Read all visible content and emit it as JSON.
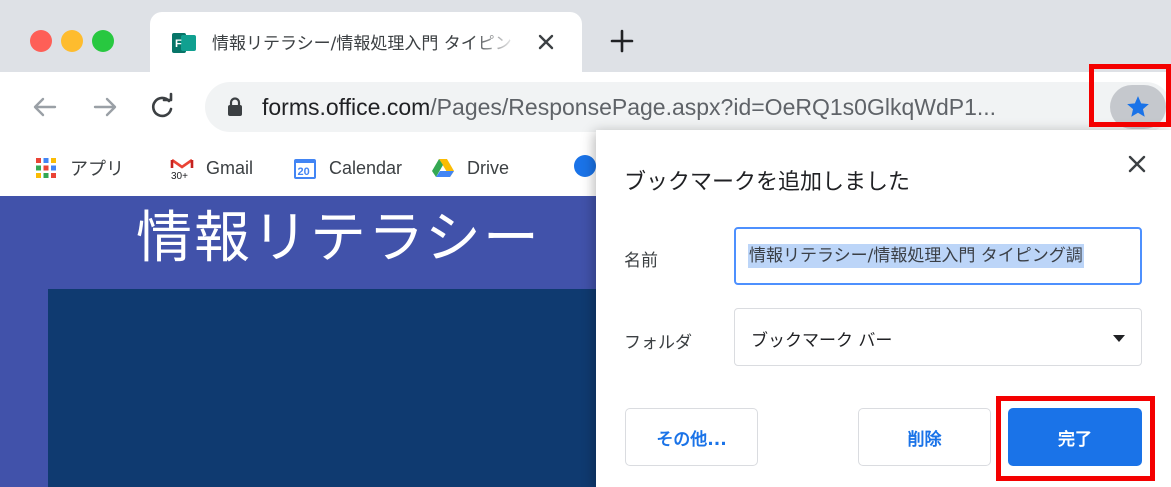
{
  "browser": {
    "tab": {
      "title": "情報リテラシー/情報処理入門 タイピング",
      "favicon": "ms-forms-icon",
      "close": "×"
    },
    "new_tab": "+",
    "toolbar": {
      "back": "←",
      "forward": "→",
      "reload": "C"
    },
    "omnibox": {
      "host": "forms.office.com",
      "path": "/Pages/ResponsePage.aspx?id=OeRQ1s0GlkqWdP1...",
      "bookmark_icon": "star-icon"
    },
    "bookmarks_bar": [
      {
        "label": "アプリ",
        "icon": "apps-grid-icon"
      },
      {
        "label": "Gmail",
        "icon": "gmail-icon",
        "badge": "30+"
      },
      {
        "label": "Calendar",
        "icon": "calendar-icon",
        "badge": "20"
      },
      {
        "label": "Drive",
        "icon": "drive-icon"
      }
    ]
  },
  "page": {
    "hero_title": "情報リテラシー"
  },
  "bookmark_bubble": {
    "title": "ブックマークを追加しました",
    "name_label": "名前",
    "name_value": "情報リテラシー/情報処理入門 タイピング調",
    "folder_label": "フォルダ",
    "folder_value": "ブックマーク バー",
    "more_button": "その他...",
    "delete_button": "削除",
    "done_button": "完了"
  },
  "colors": {
    "accent": "#1a73e8",
    "highlight": "#f40000",
    "page_background": "#4152aa",
    "hero_background": "#0f3a70"
  }
}
